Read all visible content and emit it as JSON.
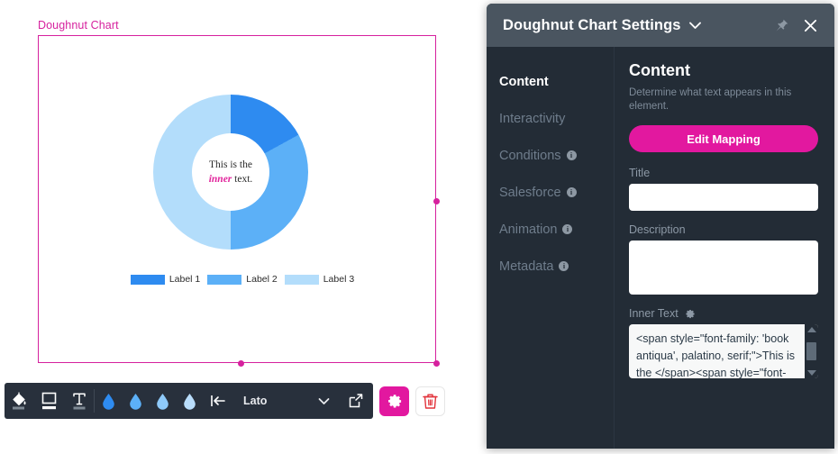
{
  "canvas": {
    "selection_label": "Doughnut Chart",
    "inner_text_line1": "This is the",
    "inner_text_emphasis": "inner",
    "inner_text_line2_suffix": " text."
  },
  "chart_data": {
    "type": "pie",
    "title": "Doughnut Chart",
    "categories": [
      "Label 1",
      "Label 2",
      "Label 3"
    ],
    "values": [
      17,
      33,
      50
    ],
    "colors": [
      "#2e8bf0",
      "#5cb0f7",
      "#b3ddfb"
    ],
    "inner_radius_ratio": 0.5,
    "legend_position": "bottom",
    "start_angle_deg": 0,
    "grid": false,
    "annotations": [
      "This is the inner text."
    ]
  },
  "legend": [
    {
      "label": "Label 1",
      "color": "#2e8bf0"
    },
    {
      "label": "Label 2",
      "color": "#5cb0f7"
    },
    {
      "label": "Label 3",
      "color": "#b3ddfb"
    }
  ],
  "toolbar": {
    "fill_icon": "paint-bucket-icon",
    "shape_icon": "shape-border-icon",
    "text_icon": "text-format-icon",
    "align_icon": "align-left-icon",
    "font_name": "Lato",
    "font_caret_icon": "chevron-down-icon",
    "export_icon": "external-link-icon",
    "gear_icon": "gear-icon",
    "trash_icon": "trash-icon",
    "swatches": [
      {
        "name": "color-drop-1",
        "color": "#2e8bf0"
      },
      {
        "name": "color-drop-2",
        "color": "#5cb0f7"
      },
      {
        "name": "color-drop-3",
        "color": "#8ec9f9"
      },
      {
        "name": "color-drop-4",
        "color": "#b9ddfb"
      }
    ]
  },
  "panel": {
    "title": "Doughnut Chart Settings",
    "title_caret_icon": "chevron-down-icon",
    "pin_icon": "pin-icon",
    "close_icon": "close-icon",
    "nav": [
      {
        "label": "Content",
        "active": true,
        "info": false
      },
      {
        "label": "Interactivity",
        "active": false,
        "info": false
      },
      {
        "label": "Conditions",
        "active": false,
        "info": true
      },
      {
        "label": "Salesforce",
        "active": false,
        "info": true
      },
      {
        "label": "Animation",
        "active": false,
        "info": true
      },
      {
        "label": "Metadata",
        "active": false,
        "info": true
      }
    ],
    "content": {
      "heading": "Content",
      "description": "Determine what text appears in this element.",
      "edit_mapping_label": "Edit Mapping",
      "title_label": "Title",
      "title_value": "",
      "description_label": "Description",
      "description_value": "",
      "inner_text_label": "Inner Text",
      "inner_text_gear_icon": "gear-icon",
      "inner_text_value": "<span style=\"font-family: 'book antiqua', palatino, serif;\">This is the </span><span style=\"font-"
    }
  }
}
